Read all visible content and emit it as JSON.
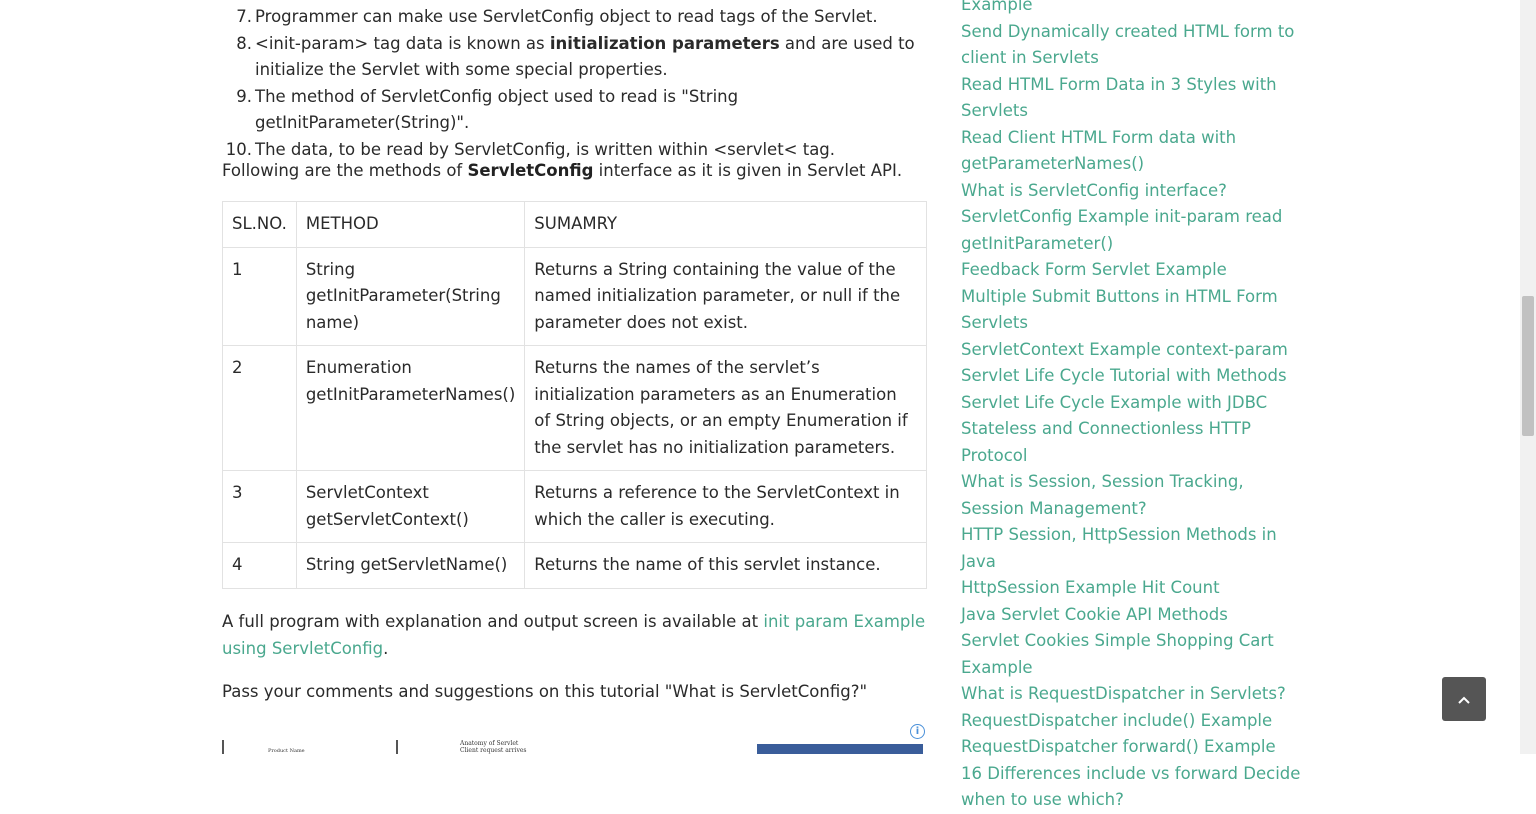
{
  "list_items": [
    {
      "num": "7.",
      "text": "Programmer can make use ServletConfig object to read tags of the Servlet."
    },
    {
      "num": "8.",
      "pre": "<init-param> tag data is known as ",
      "bold": "initialization parameters",
      "post": " and are used to initialize the Servlet with some special properties."
    },
    {
      "num": "9.",
      "text": "The method of ServletConfig object used to read is \"String getInitParameter(String)\"."
    },
    {
      "num": "10.",
      "text": "The data, to be read by ServletConfig, is written within <servlet< tag."
    }
  ],
  "methods_intro": {
    "pre": "Following are the methods of ",
    "bold": "ServletConfig",
    "post": " interface as it is given in Servlet API."
  },
  "table": {
    "headers": [
      "SL.NO.",
      "METHOD",
      "SUMAMRY"
    ],
    "rows": [
      {
        "sl": "1",
        "method": "String getInitParameter(String name)",
        "summary": "Returns a String containing the value of the named initialization parameter, or null if the parameter does not exist."
      },
      {
        "sl": "2",
        "method": "Enumeration getInitParameterNames()",
        "summary": "Returns the names of the servlet’s initialization parameters as an Enumeration of String objects, or an empty Enumeration if the servlet has no initialization parameters."
      },
      {
        "sl": "3",
        "method": "ServletContext getServletContext()",
        "summary": "Returns a reference to the ServletContext in which the caller is executing."
      },
      {
        "sl": "4",
        "method": "String getServletName()",
        "summary": "Returns the name of this servlet instance."
      }
    ]
  },
  "full_program": {
    "pre": "A full program with explanation and output screen is available at ",
    "link": "init param Example using ServletConfig",
    "post": "."
  },
  "comments_text": "Pass your comments and suggestions on this tutorial \"What is ServletConfig?\"",
  "ad": {
    "thumb1_text": "Product Name",
    "thumb2_title": "Anatomy of Servlet",
    "thumb2_sub": "Client request arrives",
    "info_glyph": "i"
  },
  "sidebar_links": [
    "Example",
    "Send Dynamically created HTML form to client in Servlets",
    "Read HTML Form Data in 3 Styles with Servlets",
    "Read Client HTML Form data with getParameterNames()",
    "What is ServletConfig interface?",
    "ServletConfig Example init-param read getInitParameter()",
    "Feedback Form Servlet Example",
    "Multiple Submit Buttons in HTML Form Servlets",
    "ServletContext Example context-param",
    "Servlet Life Cycle Tutorial with Methods",
    "Servlet Life Cycle Example with JDBC",
    "Stateless and Connectionless HTTP Protocol",
    "What is Session, Session Tracking, Session Management?",
    "HTTP Session, HttpSession Methods in Java",
    "HttpSession Example Hit Count",
    "Java Servlet Cookie API Methods",
    "Servlet Cookies Simple Shopping Cart Example",
    "What is RequestDispatcher in Servlets?",
    "RequestDispatcher include() Example",
    "RequestDispatcher forward() Example",
    "16 Differences include vs forward Decide when to use which?"
  ],
  "back_to_top_glyph": "⌃",
  "colors": {
    "link": "#4aa88e",
    "text": "#2a2a2a",
    "back_to_top_bg": "#555555"
  }
}
